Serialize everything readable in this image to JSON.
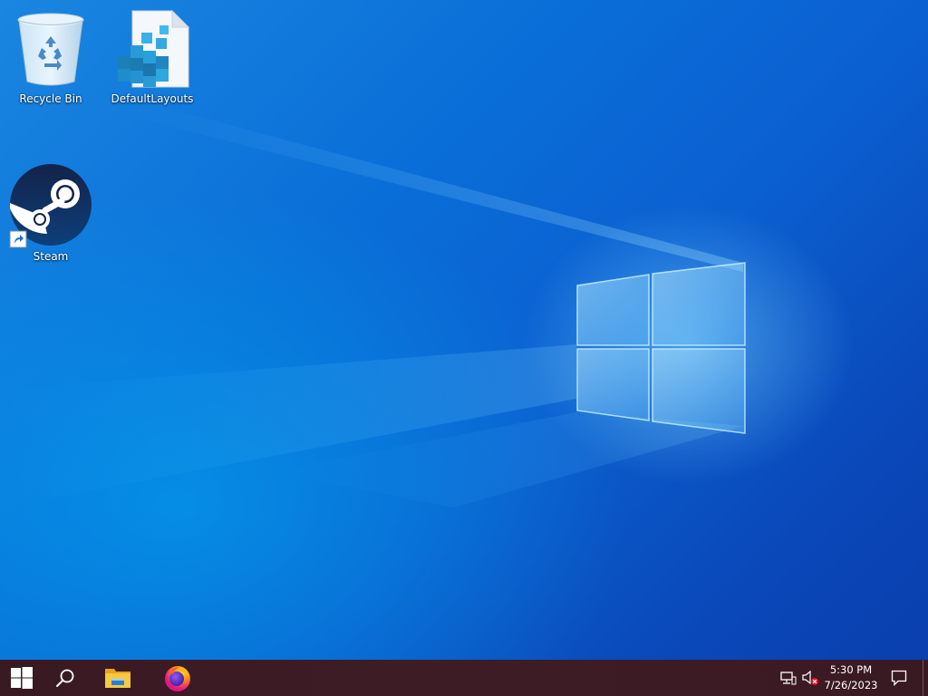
{
  "desktop": {
    "icons": [
      {
        "label": "Recycle Bin",
        "icon": "recycle-bin-icon"
      },
      {
        "label": "DefaultLayouts",
        "icon": "registry-file-icon"
      },
      {
        "label": "Steam",
        "icon": "steam-icon",
        "shortcut": true
      }
    ]
  },
  "taskbar": {
    "buttons": [
      {
        "icon": "windows-start-icon"
      },
      {
        "icon": "search-icon"
      },
      {
        "icon": "file-explorer-icon"
      },
      {
        "icon": "firefox-icon"
      }
    ],
    "tray": {
      "network_icon": "network-icon",
      "volume_icon": "volume-muted-icon",
      "time": "5:30 PM",
      "date": "7/26/2023",
      "notification_icon": "action-center-icon"
    },
    "colors": {
      "background": "#3b1c24"
    }
  },
  "wallpaper": {
    "colors": {
      "primary": "#0a6fd8",
      "light": "#78d2ff"
    }
  }
}
